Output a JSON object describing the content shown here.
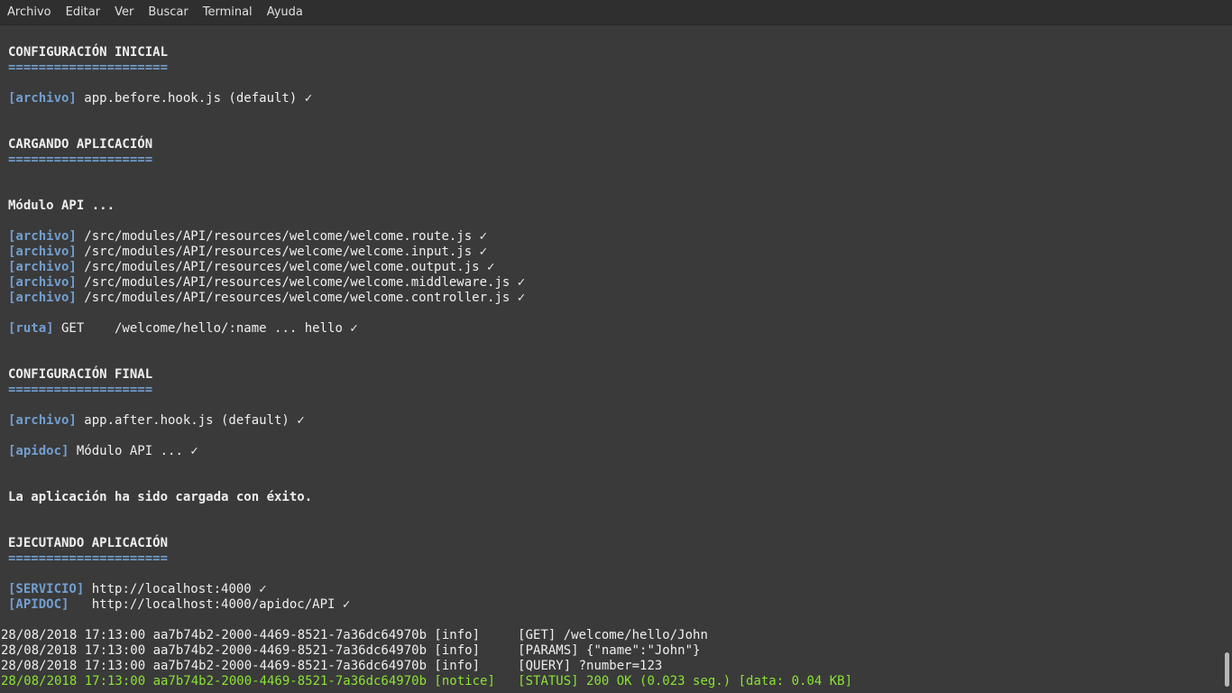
{
  "menu": [
    "Archivo",
    "Editar",
    "Ver",
    "Buscar",
    "Terminal",
    "Ayuda"
  ],
  "sections": {
    "initial": {
      "title": "CONFIGURACIÓN INICIAL",
      "underline": "====================="
    },
    "loading": {
      "title": "CARGANDO APLICACIÓN",
      "underline": "==================="
    },
    "final": {
      "title": "CONFIGURACIÓN FINAL",
      "underline": "==================="
    },
    "running": {
      "title": "EJECUTANDO APLICACIÓN",
      "underline": "====================="
    }
  },
  "lines": {
    "before_hook": {
      "tag": "[archivo]",
      "text": " app.before.hook.js (default) ✓"
    },
    "module_api": "Módulo API ...",
    "files": [
      {
        "tag": "[archivo]",
        "text": " /src/modules/API/resources/welcome/welcome.route.js ✓"
      },
      {
        "tag": "[archivo]",
        "text": " /src/modules/API/resources/welcome/welcome.input.js ✓"
      },
      {
        "tag": "[archivo]",
        "text": " /src/modules/API/resources/welcome/welcome.output.js ✓"
      },
      {
        "tag": "[archivo]",
        "text": " /src/modules/API/resources/welcome/welcome.middleware.js ✓"
      },
      {
        "tag": "[archivo]",
        "text": " /src/modules/API/resources/welcome/welcome.controller.js ✓"
      }
    ],
    "route": {
      "tag": "[ruta]",
      "text": " GET    /welcome/hello/:name ... hello ✓"
    },
    "after_hook": {
      "tag": "[archivo]",
      "text": " app.after.hook.js (default) ✓"
    },
    "apidoc": {
      "tag": "[apidoc]",
      "text": " Módulo API ... ✓"
    },
    "success": "La aplicación ha sido cargada con éxito.",
    "service": {
      "tag": "[SERVICIO]",
      "text": " http://localhost:4000 ✓"
    },
    "apidoc_url": {
      "tag": "[APIDOC]",
      "text": "   http://localhost:4000/apidoc/API ✓"
    }
  },
  "logs": [
    {
      "text": "28/08/2018 17:13:00 aa7b74b2-2000-4469-8521-7a36dc64970b [info]     [GET] /welcome/hello/John",
      "level": "info"
    },
    {
      "text": "28/08/2018 17:13:00 aa7b74b2-2000-4469-8521-7a36dc64970b [info]     [PARAMS] {\"name\":\"John\"}",
      "level": "info"
    },
    {
      "text": "28/08/2018 17:13:00 aa7b74b2-2000-4469-8521-7a36dc64970b [info]     [QUERY] ?number=123",
      "level": "info"
    },
    {
      "text": "28/08/2018 17:13:00 aa7b74b2-2000-4469-8521-7a36dc64970b [notice]   [STATUS] 200 OK (0.023 seg.) [data: 0.04 KB]",
      "level": "notice"
    }
  ],
  "colors": {
    "background": "#3a3a3a",
    "tag_blue": "#729fcf",
    "notice_green": "#8ae234",
    "text": "#efefef"
  }
}
